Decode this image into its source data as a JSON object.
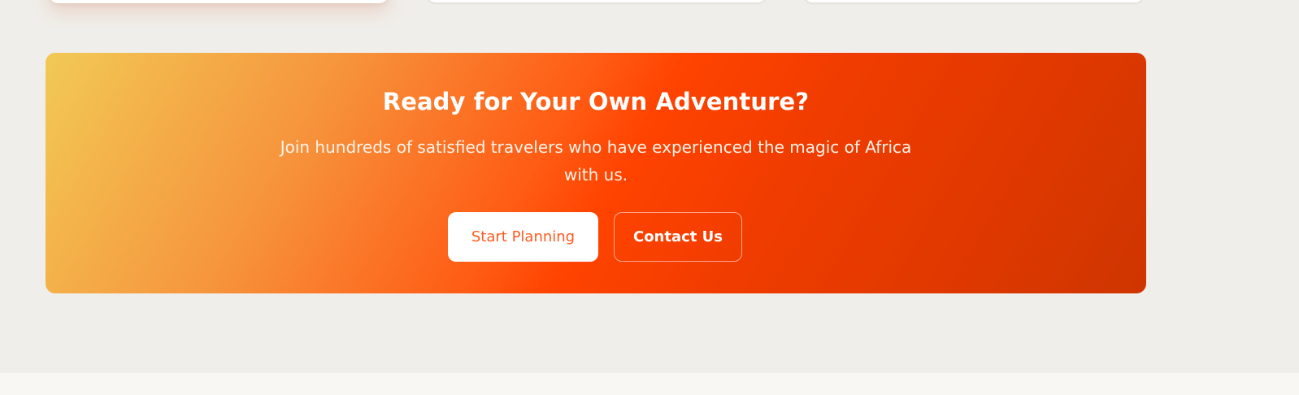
{
  "cta": {
    "title": "Ready for Your Own Adventure?",
    "subtitle": "Join hundreds of satisfied travelers who have experienced the magic of Africa with us.",
    "primary_button": "Start Planning",
    "secondary_button": "Contact Us"
  },
  "colors": {
    "page_background": "#f0eeea",
    "gradient_start": "#f2c955",
    "gradient_mid": "#ff4300",
    "gradient_end": "#cf3500",
    "primary_button_text": "#ff5a1f"
  }
}
